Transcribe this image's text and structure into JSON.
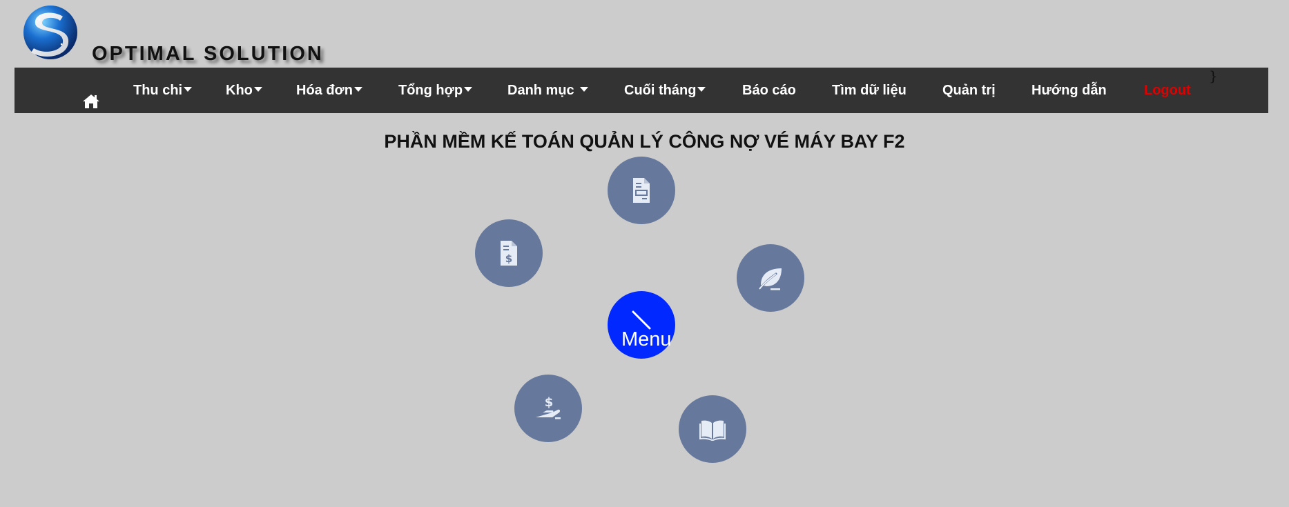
{
  "brand": {
    "name": "OPTIMAL SOLUTION"
  },
  "nav": {
    "home_icon": "home-icon",
    "items": [
      {
        "label": "Thu chi",
        "dropdown": true
      },
      {
        "label": "Kho",
        "dropdown": true
      },
      {
        "label": "Hóa đơn",
        "dropdown": true
      },
      {
        "label": "Tổng hợp",
        "dropdown": true
      },
      {
        "label": "Danh mục",
        "dropdown": true
      },
      {
        "label": "Cuối tháng",
        "dropdown": true
      },
      {
        "label": "Báo cáo",
        "dropdown": false
      },
      {
        "label": "Tìm dữ liệu",
        "dropdown": false
      },
      {
        "label": "Quản trị",
        "dropdown": false
      },
      {
        "label": "Hướng dẫn",
        "dropdown": false
      },
      {
        "label": "Logout",
        "dropdown": false
      }
    ],
    "stray_text": "}"
  },
  "page": {
    "title": "PHẦN MỀM KẾ TOÁN QUẢN LÝ CÔNG NỢ VÉ MÁY BAY F2"
  },
  "radial_menu": {
    "center_label": "Menu",
    "items": [
      {
        "icon": "invoice-document-icon"
      },
      {
        "icon": "dollar-document-icon"
      },
      {
        "icon": "leaf-icon"
      },
      {
        "icon": "hand-money-icon"
      },
      {
        "icon": "open-book-icon"
      }
    ]
  },
  "colors": {
    "background": "#cccccc",
    "navbar": "#333333",
    "nav_text": "#ffffff",
    "logout": "#e00000",
    "circle": "#66789c",
    "menu_button": "#0028ff"
  }
}
